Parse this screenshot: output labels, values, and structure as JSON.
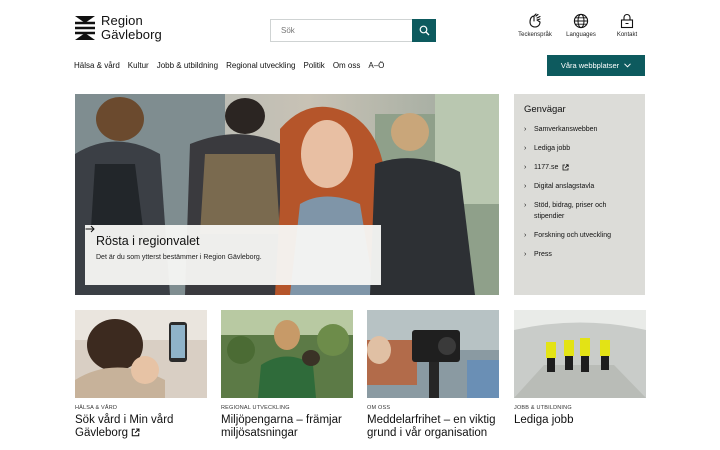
{
  "header": {
    "logo_line1": "Region",
    "logo_line2": "Gävleborg",
    "search_placeholder": "Sök",
    "utilities": [
      {
        "label": "Teckenspråk",
        "icon": "sign-language-icon"
      },
      {
        "label": "Languages",
        "icon": "globe-icon"
      },
      {
        "label": "Kontakt",
        "icon": "contact-icon"
      }
    ]
  },
  "nav": {
    "items": [
      "Hälsa & vård",
      "Kultur",
      "Jobb & utbildning",
      "Regional utveckling",
      "Politik",
      "Om oss",
      "A–Ö"
    ],
    "cta": "Våra webbplatser"
  },
  "hero": {
    "title": "Rösta i regionvalet",
    "subtitle": "Det är du som ytterst bestämmer i Region Gävleborg."
  },
  "shortcuts": {
    "title": "Genvägar",
    "items": [
      "Samverkanswebben",
      "Lediga jobb",
      "1177.se",
      "Digital anslagstavla",
      "Stöd, bidrag, priser och stipendier",
      "Forskning och utveckling",
      "Press"
    ]
  },
  "cards": [
    {
      "category": "HÄLSA & VÅRD",
      "title": "Sök vård i Min vård Gävleborg"
    },
    {
      "category": "REGIONAL UTVECKLING",
      "title": "Miljöpengarna – främjar miljösatsningar"
    },
    {
      "category": "OM OSS",
      "title": "Meddelarfrihet – en viktig grund i vår organisation"
    },
    {
      "category": "JOBB & UTBILDNING",
      "title": "Lediga jobb"
    }
  ],
  "colors": {
    "brand": "#0d5a5e",
    "shortcut_bg": "#dcdcd8"
  }
}
